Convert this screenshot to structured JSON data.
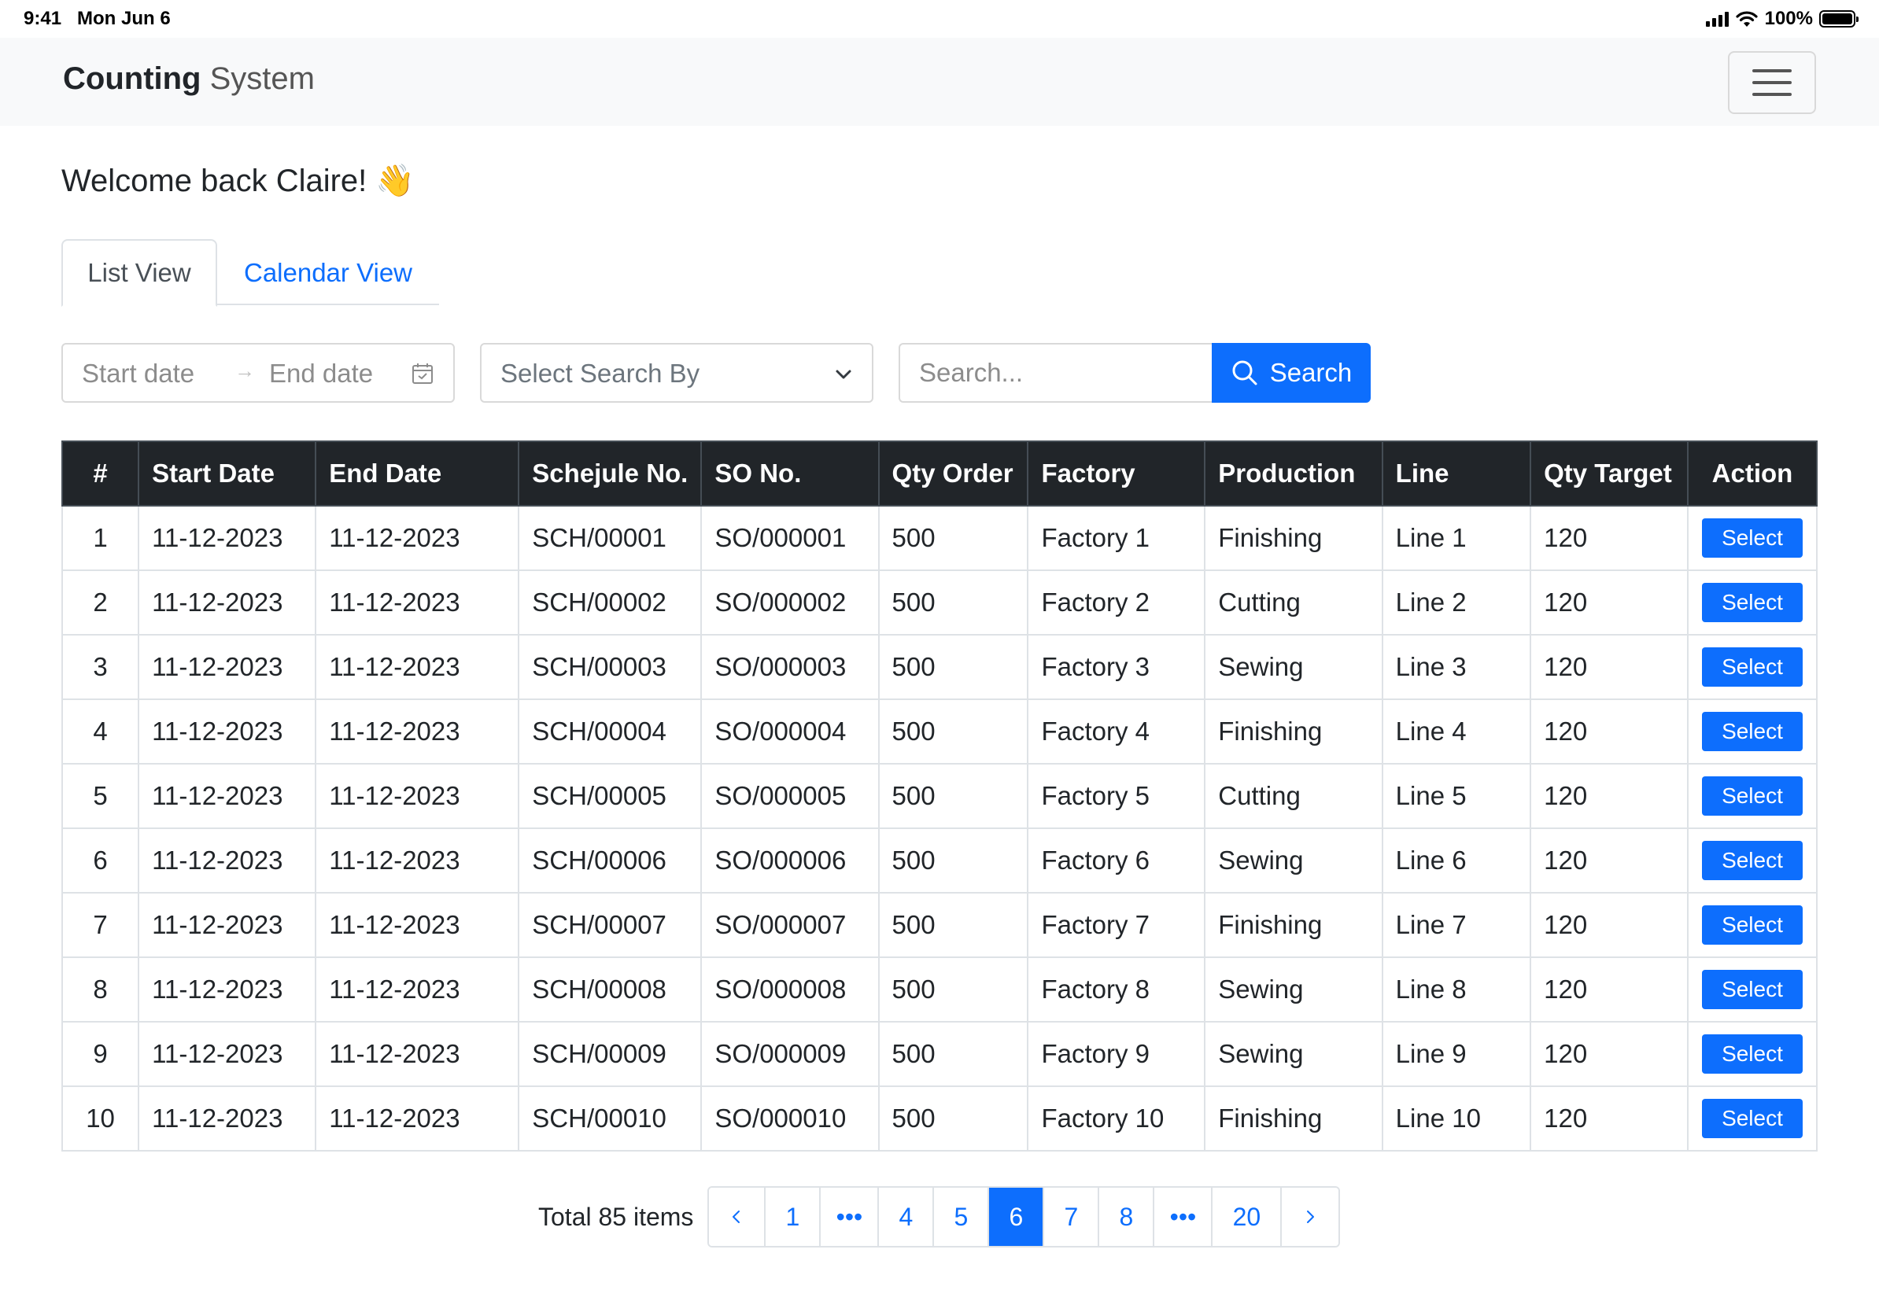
{
  "status_bar": {
    "time": "9:41",
    "date": "Mon Jun 6",
    "battery": "100%"
  },
  "navbar": {
    "brand_bold": "Counting",
    "brand_light": "System",
    "menu_icon": "hamburger-menu-icon"
  },
  "welcome": "Welcome back Claire! 👋",
  "tabs": [
    {
      "label": "List View",
      "active": true
    },
    {
      "label": "Calendar View",
      "active": false
    }
  ],
  "filters": {
    "start_date_placeholder": "Start date",
    "end_date_placeholder": "End date",
    "search_by_placeholder": "Select Search By",
    "search_placeholder": "Search...",
    "search_button": "Search"
  },
  "table": {
    "columns": [
      "#",
      "Start Date",
      "End Date",
      "Schejule No.",
      "SO No.",
      "Qty Order",
      "Factory",
      "Production",
      "Line",
      "Qty Target",
      "Action"
    ],
    "rows": [
      [
        "1",
        "11-12-2023",
        "11-12-2023",
        "SCH/00001",
        "SO/000001",
        "500",
        "Factory 1",
        "Finishing",
        "Line 1",
        "120",
        "Select"
      ],
      [
        "2",
        "11-12-2023",
        "11-12-2023",
        "SCH/00002",
        "SO/000002",
        "500",
        "Factory 2",
        "Cutting",
        "Line 2",
        "120",
        "Select"
      ],
      [
        "3",
        "11-12-2023",
        "11-12-2023",
        "SCH/00003",
        "SO/000003",
        "500",
        "Factory 3",
        "Sewing",
        "Line 3",
        "120",
        "Select"
      ],
      [
        "4",
        "11-12-2023",
        "11-12-2023",
        "SCH/00004",
        "SO/000004",
        "500",
        "Factory 4",
        "Finishing",
        "Line 4",
        "120",
        "Select"
      ],
      [
        "5",
        "11-12-2023",
        "11-12-2023",
        "SCH/00005",
        "SO/000005",
        "500",
        "Factory 5",
        "Cutting",
        "Line 5",
        "120",
        "Select"
      ],
      [
        "6",
        "11-12-2023",
        "11-12-2023",
        "SCH/00006",
        "SO/000006",
        "500",
        "Factory 6",
        "Sewing",
        "Line 6",
        "120",
        "Select"
      ],
      [
        "7",
        "11-12-2023",
        "11-12-2023",
        "SCH/00007",
        "SO/000007",
        "500",
        "Factory 7",
        "Finishing",
        "Line 7",
        "120",
        "Select"
      ],
      [
        "8",
        "11-12-2023",
        "11-12-2023",
        "SCH/00008",
        "SO/000008",
        "500",
        "Factory 8",
        "Sewing",
        "Line 8",
        "120",
        "Select"
      ],
      [
        "9",
        "11-12-2023",
        "11-12-2023",
        "SCH/00009",
        "SO/000009",
        "500",
        "Factory 9",
        "Sewing",
        "Line 9",
        "120",
        "Select"
      ],
      [
        "10",
        "11-12-2023",
        "11-12-2023",
        "SCH/00010",
        "SO/000010",
        "500",
        "Factory 10",
        "Finishing",
        "Line 10",
        "120",
        "Select"
      ]
    ]
  },
  "pagination": {
    "total_label": "Total 85 items",
    "items": [
      {
        "label": "",
        "type": "prev"
      },
      {
        "label": "1",
        "type": "page"
      },
      {
        "label": "•••",
        "type": "ellipsis"
      },
      {
        "label": "4",
        "type": "page"
      },
      {
        "label": "5",
        "type": "page"
      },
      {
        "label": "6",
        "type": "page",
        "active": true
      },
      {
        "label": "7",
        "type": "page"
      },
      {
        "label": "8",
        "type": "page"
      },
      {
        "label": "•••",
        "type": "ellipsis"
      },
      {
        "label": "20",
        "type": "page"
      },
      {
        "label": "",
        "type": "next"
      }
    ]
  },
  "colors": {
    "primary": "#0d6efd",
    "table_header": "#212529",
    "navbar": "#f8f9fa"
  }
}
